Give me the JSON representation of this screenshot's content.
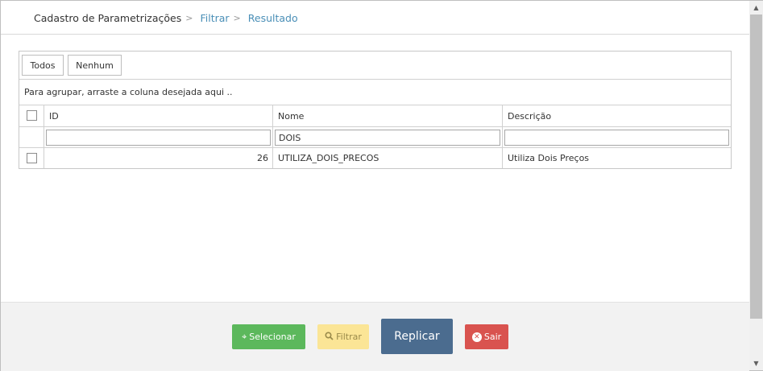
{
  "breadcrumb": {
    "items": [
      {
        "label": "Cadastro de Parametrizações",
        "separator": ">"
      },
      {
        "label": "Filtrar",
        "separator": ">"
      },
      {
        "label": "Resultado"
      }
    ]
  },
  "grid": {
    "toolbar": {
      "all_label": "Todos",
      "none_label": "Nenhum"
    },
    "group_hint": "Para agrupar, arraste a coluna desejada aqui ..",
    "columns": [
      {
        "label": "ID"
      },
      {
        "label": "Nome"
      },
      {
        "label": "Descrição"
      }
    ],
    "filters": {
      "id": "",
      "nome": "DOIS",
      "descricao": ""
    },
    "rows": [
      {
        "id": "26",
        "nome": "UTILIZA_DOIS_PRECOS",
        "descricao": "Utiliza Dois Preços",
        "checked": false
      }
    ]
  },
  "footer": {
    "selecionar_label": "Selecionar",
    "filtrar_label": "Filtrar",
    "replicar_label": "Replicar",
    "sair_label": "Sair"
  },
  "colors": {
    "link": "#4a8fb7",
    "selecionar": "#5cb85c",
    "filtrar": "#fbe596",
    "replicar": "#4b6c8f",
    "sair": "#d9534f"
  },
  "icons": {
    "selecionar": "crosshair-icon",
    "filtrar": "search-icon",
    "sair": "close-circle-icon"
  }
}
